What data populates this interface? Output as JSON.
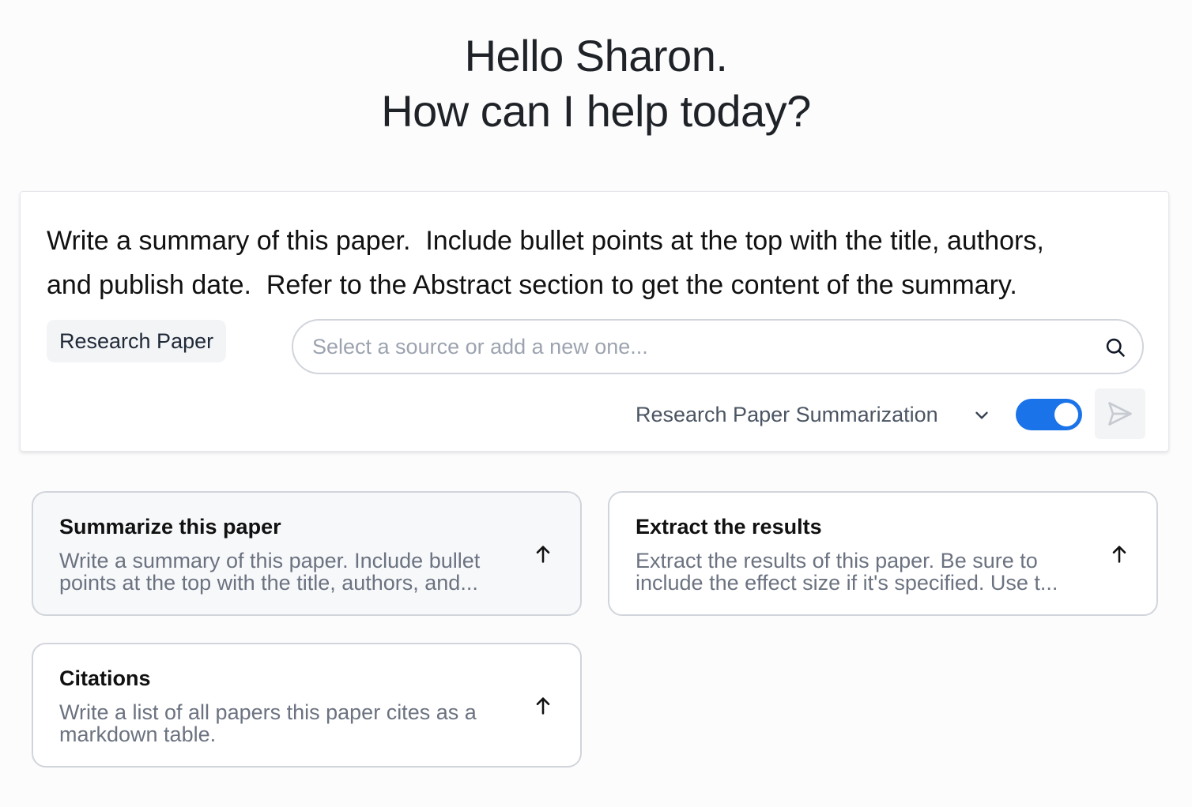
{
  "greeting": {
    "line1": "Hello Sharon.",
    "line2": "How can I help today?"
  },
  "prompt": {
    "text": "Write a summary of this paper.  Include bullet points at the top with the title, authors,\nand publish date.  Refer to the Abstract section to get the content of the summary."
  },
  "source": {
    "chip_label": "Research Paper",
    "search_placeholder": "Select a source or add a new one...",
    "search_value": ""
  },
  "controls": {
    "template_selected": "Research Paper Summarization",
    "toggle_on": true,
    "accent_color": "#1a73e8"
  },
  "suggestions": [
    {
      "title": "Summarize this paper",
      "desc_line1": "Write a summary of this paper. Include bullet",
      "desc_line2": "points at the top with the title, authors, and..."
    },
    {
      "title": "Extract the results",
      "desc_line1": "Extract the results of this paper. Be sure to",
      "desc_line2": "include the effect size if it's specified. Use t..."
    },
    {
      "title": "Citations",
      "desc_line1": "Write a list of all papers this paper cites as a",
      "desc_line2": "markdown table."
    }
  ],
  "icons": {
    "search": "search-icon",
    "dropdown": "chevron-down-icon",
    "send": "send-icon",
    "suggestion_action": "arrow-up-icon"
  }
}
